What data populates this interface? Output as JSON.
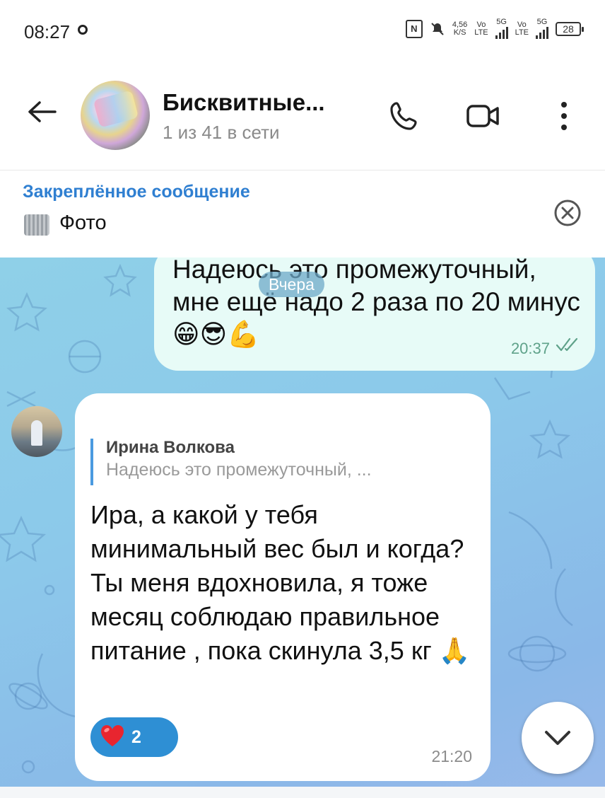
{
  "status_bar": {
    "time": "08:27",
    "speed_value": "4,56",
    "speed_unit": "K/S",
    "sim1_top": "Vo",
    "sim1_bottom": "LTE",
    "sim1_net": "5G",
    "sim2_top": "Vo",
    "sim2_bottom": "LTE",
    "sim2_net": "5G",
    "battery": "28",
    "nfc_label": "N"
  },
  "header": {
    "title": "Бисквитные...",
    "subtitle": "1 из 41 в сети",
    "icons": [
      "back-arrow-icon",
      "phone-icon",
      "video-icon",
      "more-vertical-icon"
    ]
  },
  "pinned": {
    "title": "Закреплённое сообщение",
    "text": "Фото"
  },
  "chat": {
    "date_label": "Вчера",
    "outgoing": {
      "text": "Надеюсь это промежуточный, мне ещё надо 2 раза по 20 минус😁😎💪",
      "time": "20:37"
    },
    "incoming": {
      "reply_name": "Ирина Волкова",
      "reply_text": "Надеюсь это промежуточный, ...",
      "text": "Ира, а какой у тебя минимальный вес был и когда? Ты меня вдохновила, я тоже месяц соблюдаю правильное питание , пока скинула 3,5 кг 🙏",
      "reaction_emoji": "❤️",
      "reaction_count": "2",
      "time": "21:20"
    }
  },
  "colors": {
    "accent": "#2f7fd1",
    "outgoing_bubble": "#e7fbf7",
    "reaction_pill": "#2e8fd4"
  }
}
